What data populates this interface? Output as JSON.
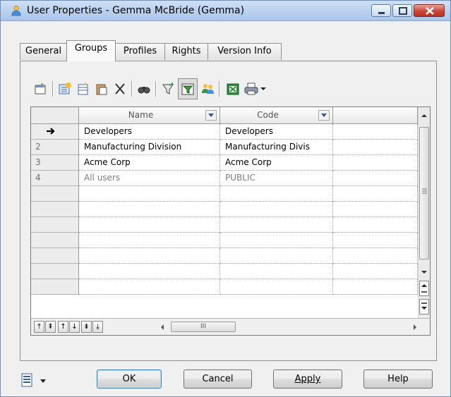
{
  "window": {
    "title": "User Properties - Gemma McBride (Gemma)",
    "accent_color": "#b9d1ee",
    "close_color": "#c9463a"
  },
  "tabs": [
    {
      "label": "General",
      "active": false
    },
    {
      "label": "Groups",
      "active": true
    },
    {
      "label": "Profiles",
      "active": false
    },
    {
      "label": "Rights",
      "active": false
    },
    {
      "label": "Version Info",
      "active": false
    }
  ],
  "toolbar": {
    "icons": [
      "properties-icon",
      "add-objects-icon",
      "create-object-icon",
      "paste-icon",
      "delete-icon",
      "find-icon",
      "filter-icon",
      "filter-columns-icon",
      "user-group-icon",
      "excel-icon",
      "print-icon",
      "dropdown-icon"
    ]
  },
  "grid": {
    "columns": [
      {
        "label": "Name"
      },
      {
        "label": "Code"
      }
    ],
    "rows": [
      {
        "row_marker": "",
        "name": "Developers",
        "code": "Developers",
        "current": true,
        "muted": false
      },
      {
        "row_marker": "2",
        "name": "Manufacturing Division",
        "code": "Manufacturing Divis",
        "current": false,
        "muted": false
      },
      {
        "row_marker": "3",
        "name": "Acme Corp",
        "code": "Acme Corp",
        "current": false,
        "muted": false
      },
      {
        "row_marker": "4",
        "name": "All users",
        "code": "PUBLIC",
        "current": false,
        "muted": true
      }
    ],
    "empty_rows": 7,
    "hscroll_thumb_label": "III"
  },
  "buttons": {
    "ok": "OK",
    "cancel": "Cancel",
    "apply": "Apply",
    "help": "Help"
  }
}
